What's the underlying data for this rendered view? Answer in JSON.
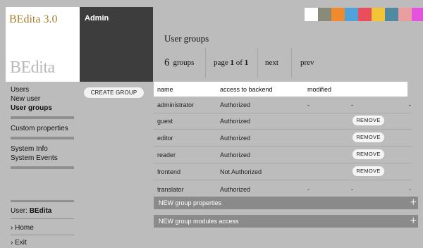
{
  "app": {
    "title": "BEdita 3.0",
    "logo_text": "BEdita",
    "module_title": "Admin"
  },
  "swatches": [
    "#ffffff",
    "#8a8a79",
    "#ef8b2c",
    "#4fa3d8",
    "#ea4d5c",
    "#f4c437",
    "#4f8aa1",
    "#e89e9f",
    "#e353dd"
  ],
  "page": {
    "title": "User groups"
  },
  "pager": {
    "count": "6",
    "count_label": "groups",
    "page_prefix": "page",
    "page_current": "1",
    "page_of": "of",
    "page_total": "1",
    "next": "next",
    "prev": "prev"
  },
  "sidebar": {
    "users": "Users",
    "new_user": "New user",
    "user_groups": "User groups",
    "custom_properties": "Custom properties",
    "system_info": "System Info",
    "system_events": "System Events"
  },
  "create_button": "CREATE GROUP",
  "table": {
    "columns": [
      "name",
      "access to backend",
      "modified"
    ],
    "rows": [
      {
        "name": "administrator",
        "access": "Authorized",
        "action": null,
        "d1": "-",
        "d2": "-",
        "d3": "-"
      },
      {
        "name": "guest",
        "access": "Authorized",
        "action": "REMOVE",
        "d1": "",
        "d2": "",
        "d3": ""
      },
      {
        "name": "editor",
        "access": "Authorized",
        "action": "REMOVE",
        "d1": "",
        "d2": "",
        "d3": ""
      },
      {
        "name": "reader",
        "access": "Authorized",
        "action": "REMOVE",
        "d1": "",
        "d2": "",
        "d3": ""
      },
      {
        "name": "frontend",
        "access": "Not Authorized",
        "action": "REMOVE",
        "d1": "",
        "d2": "",
        "d3": ""
      },
      {
        "name": "translator",
        "access": "Authorized",
        "action": null,
        "d1": "-",
        "d2": "-",
        "d3": "-"
      }
    ]
  },
  "panels": {
    "group_properties": "NEW group properties",
    "modules_access": "NEW group modules access",
    "plus": "+"
  },
  "user": {
    "label": "User:",
    "name": "BEdita"
  },
  "links": {
    "home": "› Home",
    "exit": "› Exit"
  }
}
